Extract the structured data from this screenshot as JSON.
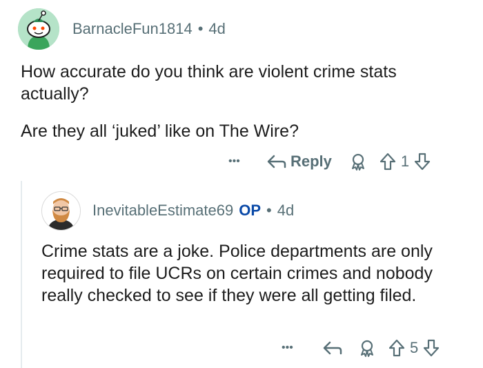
{
  "comment": {
    "username": "BarnacleFun1814",
    "separator": "•",
    "age": "4d",
    "paragraphs": [
      "How accurate do you think are violent crime stats actually?",
      "Are they all ‘juked’ like on The Wire?"
    ],
    "actions": {
      "more_label": "•••",
      "reply_label": "Reply",
      "vote_count": "1"
    }
  },
  "reply": {
    "username": "InevitableEstimate69",
    "op_badge": "OP",
    "separator": "•",
    "age": "4d",
    "paragraphs": [
      "Crime stats are a joke. Police departments are only required to file UCRs on certain crimes and nobody really checked to see if they were all getting filed."
    ],
    "actions": {
      "more_label": "•••",
      "vote_count": "5"
    }
  },
  "colors": {
    "meta_gray": "#576f76",
    "op_blue": "#0b4aa8",
    "avatar1_bg": "#9ad0b3",
    "thread_line": "#e5ebee"
  },
  "icons": [
    "snoo-avatar",
    "profile-avatar",
    "more-icon",
    "reply-arrow-icon",
    "award-icon",
    "upvote-icon",
    "downvote-icon"
  ]
}
